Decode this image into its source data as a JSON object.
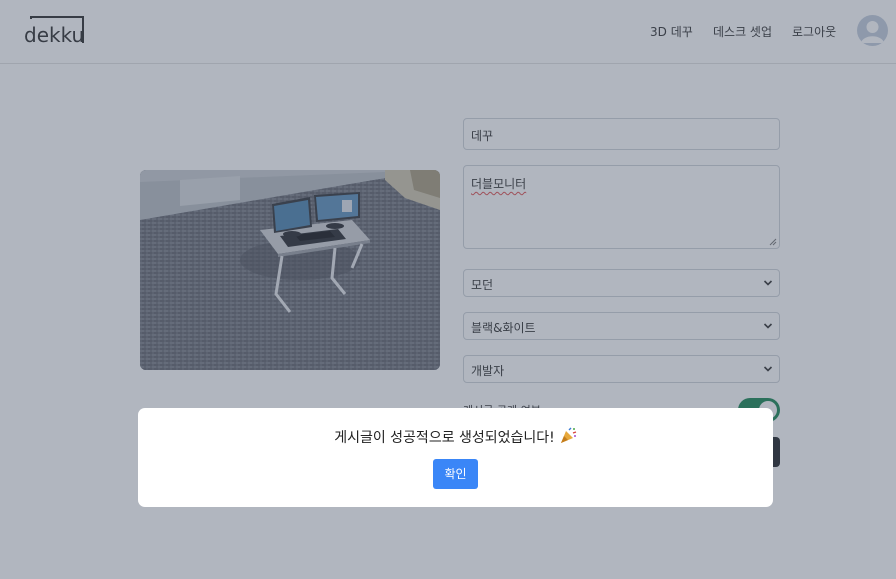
{
  "header": {
    "logo_text": "dekku",
    "nav": [
      {
        "label": "3D 데꾸"
      },
      {
        "label": "데스크 셋업"
      },
      {
        "label": "로그아웃"
      }
    ]
  },
  "form": {
    "title_value": "데꾸",
    "content_value": "더블모니터",
    "selects": [
      {
        "name": "style",
        "value": "모던"
      },
      {
        "name": "color",
        "value": "블랙&화이트"
      },
      {
        "name": "job",
        "value": "개발자"
      }
    ],
    "public_toggle_label": "게시글 공개 여부",
    "public_toggle_on": true
  },
  "modal": {
    "message": "게시글이 성공적으로 생성되었습니다!",
    "confirm_label": "확인"
  },
  "colors": {
    "toggle_on": "#198754",
    "confirm_button": "#3a86f7",
    "backdrop": "rgba(70,82,102,0.42)"
  }
}
